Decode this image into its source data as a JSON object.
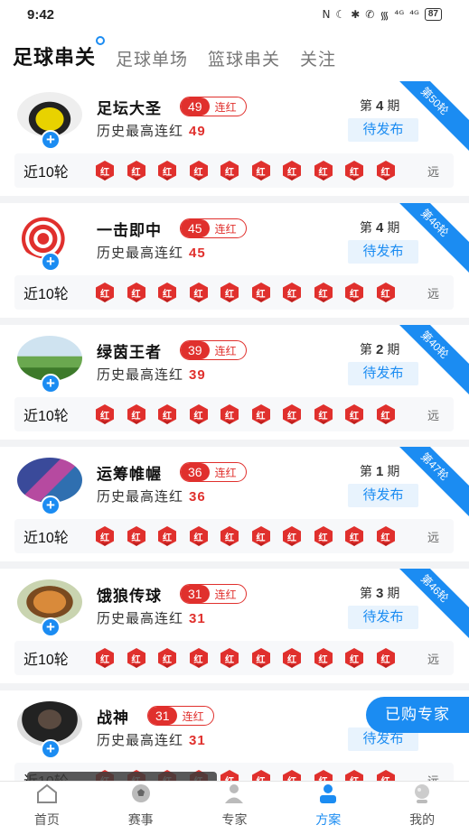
{
  "status": {
    "time": "9:42",
    "battery": "87",
    "icons": [
      "N",
      "☾",
      "✱",
      "✆",
      "᯾",
      "⁴ᴳ",
      "⁴ᴳ"
    ]
  },
  "tabs": [
    {
      "label": "足球串关",
      "active": true
    },
    {
      "label": "足球单场",
      "active": false
    },
    {
      "label": "篮球串关",
      "active": false
    },
    {
      "label": "关注",
      "active": false
    }
  ],
  "common": {
    "streak_text": "连红",
    "history_label": "历史最高连红",
    "period_prefix": "第",
    "period_suffix": "期",
    "pending_label": "待发布",
    "recent_label": "近10轮",
    "result_char": "红",
    "far_label": "远"
  },
  "experts": [
    {
      "name": "足坛大圣",
      "streak": "49",
      "history": "49",
      "period": "4",
      "ribbon": "第50轮",
      "results": [
        "红",
        "红",
        "红",
        "红",
        "红",
        "红",
        "红",
        "红",
        "红",
        "红"
      ]
    },
    {
      "name": "一击即中",
      "streak": "45",
      "history": "45",
      "period": "4",
      "ribbon": "第46轮",
      "results": [
        "红",
        "红",
        "红",
        "红",
        "红",
        "红",
        "红",
        "红",
        "红",
        "红"
      ]
    },
    {
      "name": "绿茵王者",
      "streak": "39",
      "history": "39",
      "period": "2",
      "ribbon": "第40轮",
      "results": [
        "红",
        "红",
        "红",
        "红",
        "红",
        "红",
        "红",
        "红",
        "红",
        "红"
      ]
    },
    {
      "name": "运筹帷幄",
      "streak": "36",
      "history": "36",
      "period": "1",
      "ribbon": "第47轮",
      "results": [
        "红",
        "红",
        "红",
        "红",
        "红",
        "红",
        "红",
        "红",
        "红",
        "红"
      ]
    },
    {
      "name": "饿狼传球",
      "streak": "31",
      "history": "31",
      "period": "3",
      "ribbon": "第46轮",
      "results": [
        "红",
        "红",
        "红",
        "红",
        "红",
        "红",
        "红",
        "红",
        "红",
        "红"
      ]
    },
    {
      "name": "战神",
      "streak": "31",
      "history": "31",
      "period": "",
      "ribbon": "",
      "results": [
        "红",
        "红",
        "红",
        "红",
        "红",
        "红",
        "红",
        "红",
        "红",
        "红"
      ]
    }
  ],
  "bought_button": "已购专家",
  "watermark": "thunder-gaming.com",
  "nav": [
    {
      "label": "首页",
      "icon": "home-icon",
      "active": false
    },
    {
      "label": "赛事",
      "icon": "ball-icon",
      "active": false
    },
    {
      "label": "专家",
      "icon": "expert-icon",
      "active": false
    },
    {
      "label": "方案",
      "icon": "plan-icon",
      "active": true
    },
    {
      "label": "我的",
      "icon": "profile-icon",
      "active": false
    }
  ],
  "colors": {
    "accent": "#1b8cf2",
    "red": "#e0302d"
  }
}
